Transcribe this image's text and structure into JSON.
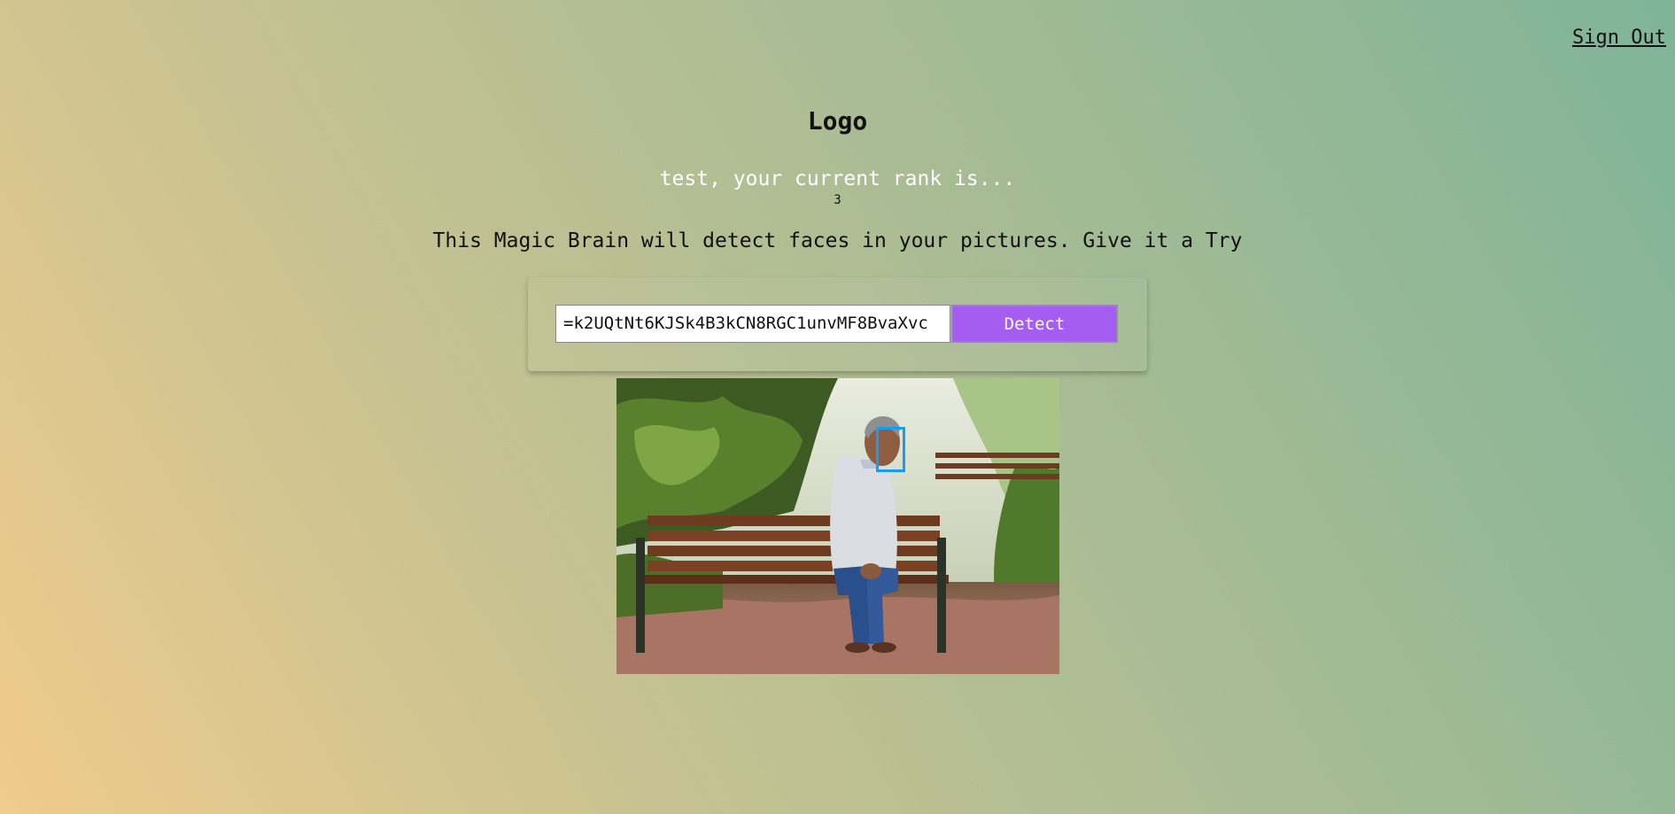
{
  "nav": {
    "signout_label": "Sign Out"
  },
  "header": {
    "logo_text": "Logo"
  },
  "rank": {
    "message": "test, your current rank is...",
    "value": "3"
  },
  "intro": {
    "tagline": "This Magic Brain will detect faces in your pictures. Give it a Try"
  },
  "form": {
    "url_value": "k2UQtNt6KJSk4B3kCN8RGC1unvMF8BvaXvc=",
    "detect_label": "Detect"
  },
  "colors": {
    "accent": "#a45df0",
    "face_box": "#149df2"
  },
  "result": {
    "image_subject": "man-sitting-on-park-bench-photo",
    "face_count": 1
  }
}
